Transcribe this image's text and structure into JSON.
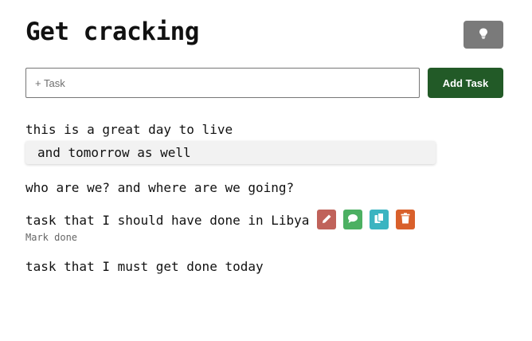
{
  "header": {
    "title": "Get cracking"
  },
  "theme_toggle": {
    "icon": "lightbulb-icon"
  },
  "new_task": {
    "placeholder": "+ Task",
    "value": "",
    "add_label": "Add Task"
  },
  "tasks": [
    {
      "text": "this is a great day to live"
    },
    {
      "text": "and tomorrow as well"
    },
    {
      "text": "who are we? and where are we going?"
    },
    {
      "text": "task that I should have done in Libya",
      "hint": "Mark done"
    },
    {
      "text": "task that I must get done today"
    }
  ],
  "task_actions": [
    {
      "icon": "pencil-icon",
      "color": "#c0625a"
    },
    {
      "icon": "comment-icon",
      "color": "#4cb062"
    },
    {
      "icon": "copy-icon",
      "color": "#3bb4c1"
    },
    {
      "icon": "trash-icon",
      "color": "#d9602b"
    }
  ],
  "colors": {
    "add_button": "#225a27",
    "toggle_button": "#7a7a7a"
  }
}
